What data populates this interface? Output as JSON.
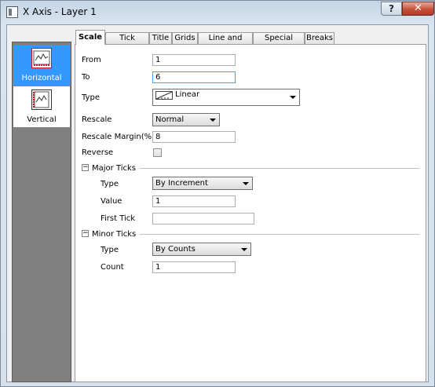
{
  "window": {
    "title": "X Axis - Layer 1",
    "help": "?",
    "close": "✕"
  },
  "sidebar": {
    "items": [
      {
        "label": "Horizontal",
        "selected": true
      },
      {
        "label": "Vertical",
        "selected": false
      }
    ]
  },
  "tabs": [
    "Scale",
    "Tick Labels",
    "Title",
    "Grids",
    "Line and Ticks",
    "Special Ticks",
    "Breaks"
  ],
  "scale": {
    "from_label": "From",
    "from_value": "1",
    "to_label": "To",
    "to_value": "6",
    "type_label": "Type",
    "type_value": "Linear",
    "rescale_label": "Rescale",
    "rescale_value": "Normal",
    "margin_label": "Rescale Margin(%)",
    "margin_value": "8",
    "reverse_label": "Reverse"
  },
  "major_ticks": {
    "header": "Major Ticks",
    "collapse": "−",
    "type_label": "Type",
    "type_value": "By Increment",
    "value_label": "Value",
    "value_value": "1",
    "first_tick_label": "First Tick",
    "first_tick_value": ""
  },
  "minor_ticks": {
    "header": "Minor Ticks",
    "collapse": "−",
    "type_label": "Type",
    "type_value": "By Counts",
    "count_label": "Count",
    "count_value": "1"
  },
  "colors": {
    "selection": "#3399ff",
    "panel": "#808080",
    "close": "#c7513c"
  }
}
